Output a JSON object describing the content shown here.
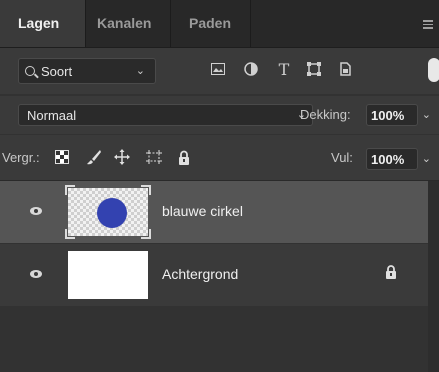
{
  "tabs": [
    {
      "label": "Lagen",
      "active": true
    },
    {
      "label": "Kanalen",
      "active": false
    },
    {
      "label": "Paden",
      "active": false
    }
  ],
  "filter": {
    "kind_label": "Soort",
    "icons": [
      "image-filter-icon",
      "adjustment-filter-icon",
      "type-filter-icon",
      "shape-filter-icon",
      "smart-object-filter-icon"
    ]
  },
  "blend": {
    "mode": "Normaal",
    "opacity_label": "Dekking:",
    "opacity_value": "100%"
  },
  "lock": {
    "label": "Vergr.:",
    "icons": [
      "lock-transparent-pixels-icon",
      "lock-image-pixels-icon",
      "lock-position-icon",
      "lock-artboard-icon",
      "lock-all-icon"
    ],
    "fill_label": "Vul:",
    "fill_value": "100%"
  },
  "layers": [
    {
      "name": "blauwe cirkel",
      "selected": true,
      "visible": true,
      "locked": false,
      "thumb_color": "#3342b0"
    },
    {
      "name": "Achtergrond",
      "selected": false,
      "visible": true,
      "locked": true,
      "thumb_color": "#ffffff"
    }
  ],
  "colors": {
    "panel_bg": "#323232",
    "selected_row": "#555555",
    "accent": "#3342b0"
  }
}
